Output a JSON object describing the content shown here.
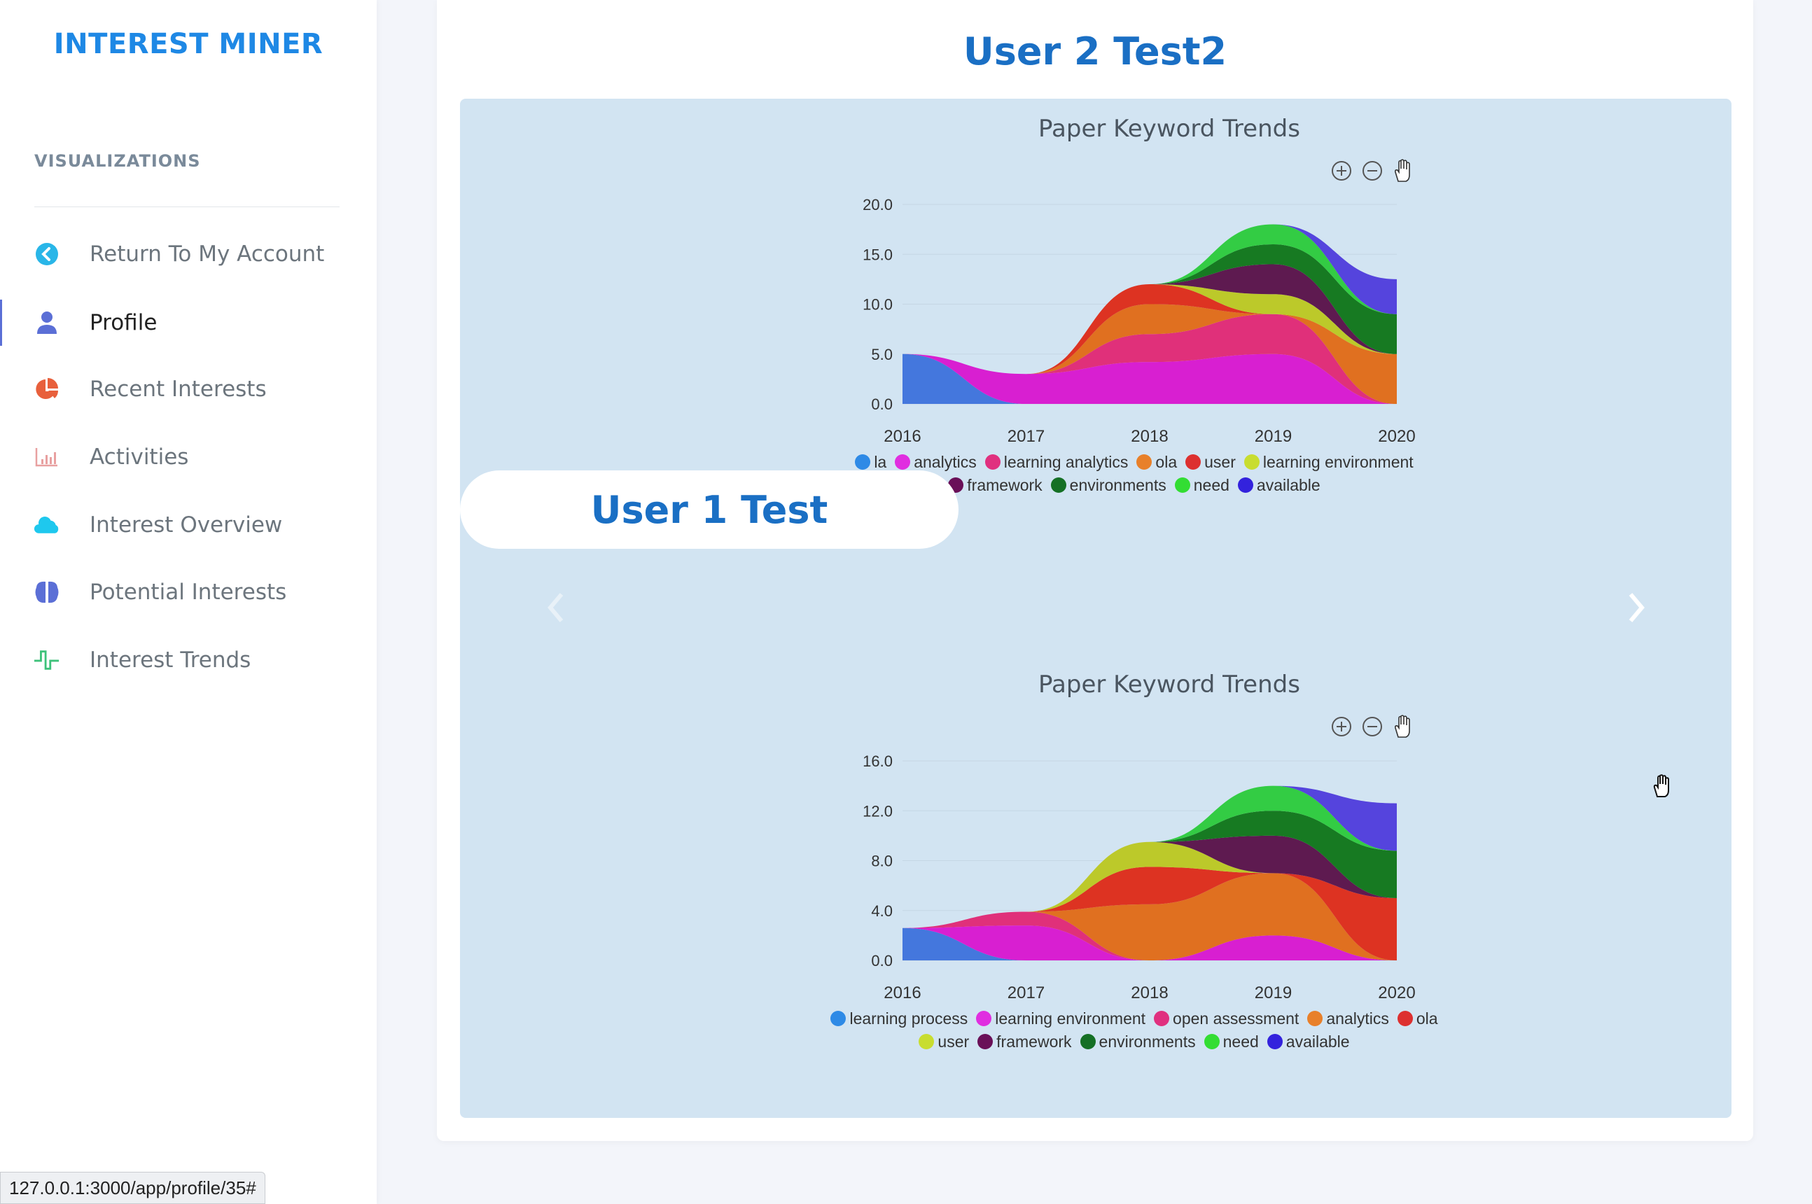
{
  "sidebar": {
    "brand": "INTEREST MINER",
    "section_label": "VISUALIZATIONS",
    "items": [
      {
        "label": "Return To My Account",
        "icon": "chevron-left-circle-icon",
        "color": "#29b6e8",
        "active": false
      },
      {
        "label": "Profile",
        "icon": "user-icon",
        "color": "#5b6fd6",
        "active": true
      },
      {
        "label": "Recent Interests",
        "icon": "pie-chart-icon",
        "color": "#e8603c",
        "active": false
      },
      {
        "label": "Activities",
        "icon": "bar-chart-icon",
        "color": "#e8a0a0",
        "active": false
      },
      {
        "label": "Interest Overview",
        "icon": "cloud-icon",
        "color": "#1ec8ee",
        "active": false
      },
      {
        "label": "Potential Interests",
        "icon": "brain-icon",
        "color": "#5b6fd6",
        "active": false
      },
      {
        "label": "Interest Trends",
        "icon": "pulse-icon",
        "color": "#3ec27a",
        "active": false
      }
    ]
  },
  "main": {
    "title": "User 2 Test2",
    "carousel_label": "User 1 Test",
    "prev_icon": "chevron-left-icon",
    "next_icon": "chevron-right-icon",
    "toolbar_icons": [
      "zoom-in-icon",
      "zoom-out-icon",
      "pan-hand-icon"
    ]
  },
  "status_bar": {
    "url": "127.0.0.1:3000/app/profile/35#"
  },
  "chart_data": [
    {
      "type": "area",
      "stacked": true,
      "smooth": true,
      "title": "Paper Keyword Trends",
      "x": [
        "2016",
        "2017",
        "2018",
        "2019",
        "2020"
      ],
      "ylim": [
        0,
        20
      ],
      "yticks": [
        "0.0",
        "5.0",
        "10.0",
        "15.0",
        "20.0"
      ],
      "legend_position": "bottom",
      "series": [
        {
          "name": "la",
          "color": "#4477dd",
          "legend_color": "#2e8ae6",
          "values": [
            5,
            0,
            0,
            0,
            0
          ]
        },
        {
          "name": "analytics",
          "color": "#d81fd1",
          "legend_color": "#e02ee0",
          "values": [
            0,
            3,
            4.2,
            5,
            0
          ]
        },
        {
          "name": "learning analytics",
          "color": "#e0307a",
          "legend_color": "#e0307f",
          "values": [
            0,
            0,
            2.8,
            4,
            0
          ]
        },
        {
          "name": "ola",
          "color": "#e07020",
          "legend_color": "#e8802a",
          "values": [
            0,
            0,
            3,
            0,
            5
          ]
        },
        {
          "name": "user",
          "color": "#dd3322",
          "legend_color": "#dd3030",
          "values": [
            0,
            0,
            2,
            0,
            0
          ]
        },
        {
          "name": "learning environment",
          "color": "#bcc92a",
          "legend_color": "#c8dd30",
          "values": [
            0,
            0,
            0,
            2,
            0
          ]
        },
        {
          "name": "framework",
          "color": "#5e1a50",
          "legend_color": "#6a1058",
          "values": [
            0,
            0,
            0,
            3,
            0
          ]
        },
        {
          "name": "environments",
          "color": "#177a22",
          "legend_color": "#157025",
          "values": [
            0,
            0,
            0,
            2,
            4
          ]
        },
        {
          "name": "need",
          "color": "#33cc44",
          "legend_color": "#33dd33",
          "values": [
            0,
            0,
            0,
            2,
            0
          ]
        },
        {
          "name": "available",
          "color": "#5544dd",
          "legend_color": "#3322dd",
          "values": [
            0,
            0,
            0,
            0,
            3.5
          ]
        }
      ]
    },
    {
      "type": "area",
      "stacked": true,
      "smooth": true,
      "title": "Paper Keyword Trends",
      "x": [
        "2016",
        "2017",
        "2018",
        "2019",
        "2020"
      ],
      "ylim": [
        0,
        16
      ],
      "yticks": [
        "0.0",
        "4.0",
        "8.0",
        "12.0",
        "16.0"
      ],
      "legend_position": "bottom",
      "series": [
        {
          "name": "learning process",
          "color": "#4477dd",
          "legend_color": "#2e8ae6",
          "values": [
            2.6,
            0,
            0,
            0,
            0
          ]
        },
        {
          "name": "learning environment",
          "color": "#d81fd1",
          "legend_color": "#e02ee0",
          "values": [
            0,
            2.8,
            0,
            2,
            0
          ]
        },
        {
          "name": "open assessment",
          "color": "#e0307a",
          "legend_color": "#e0307f",
          "values": [
            0,
            1.1,
            0,
            0,
            0
          ]
        },
        {
          "name": "analytics",
          "color": "#e07020",
          "legend_color": "#e8802a",
          "values": [
            0,
            0,
            4.5,
            5,
            0
          ]
        },
        {
          "name": "ola",
          "color": "#dd3322",
          "legend_color": "#dd3030",
          "values": [
            0,
            0,
            3,
            0,
            5
          ]
        },
        {
          "name": "user",
          "color": "#bcc92a",
          "legend_color": "#c8dd30",
          "values": [
            0,
            0,
            2,
            0,
            0
          ]
        },
        {
          "name": "framework",
          "color": "#5e1a50",
          "legend_color": "#6a1058",
          "values": [
            0,
            0,
            0,
            3,
            0
          ]
        },
        {
          "name": "environments",
          "color": "#177a22",
          "legend_color": "#157025",
          "values": [
            0,
            0,
            0,
            2,
            3.8
          ]
        },
        {
          "name": "need",
          "color": "#33cc44",
          "legend_color": "#33dd33",
          "values": [
            0,
            0,
            0,
            2,
            0
          ]
        },
        {
          "name": "available",
          "color": "#5544dd",
          "legend_color": "#3322dd",
          "values": [
            0,
            0,
            0,
            0,
            3.8
          ]
        }
      ]
    }
  ]
}
